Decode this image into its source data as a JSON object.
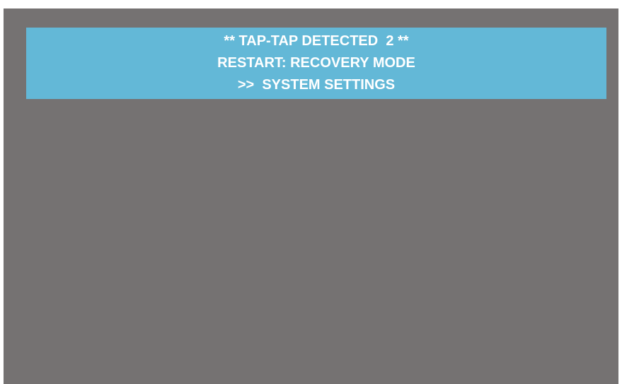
{
  "banner": {
    "line1": "** TAP-TAP DETECTED  2 **",
    "line2": "RESTART: RECOVERY MODE",
    "line3": ">>  SYSTEM SETTINGS"
  },
  "colors": {
    "screen_background": "#757272",
    "banner_background": "#63b8d7",
    "text": "#ffffff"
  }
}
